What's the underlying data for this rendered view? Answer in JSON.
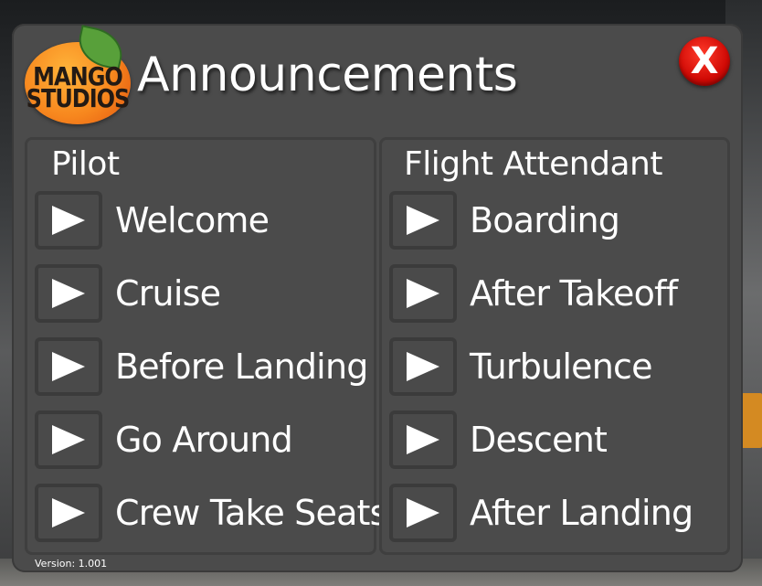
{
  "app": {
    "title": "Announcements",
    "version": "Version: 1.001",
    "close_label": "X"
  },
  "logo": {
    "line1": "MANGO",
    "line2": "STUDIOS"
  },
  "pilot": {
    "heading": "Pilot",
    "items": [
      {
        "label": "Welcome",
        "icon": "play-icon"
      },
      {
        "label": "Cruise",
        "icon": "play-icon"
      },
      {
        "label": "Before Landing",
        "icon": "play-icon"
      },
      {
        "label": "Go Around",
        "icon": "play-icon"
      },
      {
        "label": "Crew Take Seats",
        "icon": "play-icon"
      }
    ]
  },
  "flight_attendant": {
    "heading": "Flight Attendant",
    "items": [
      {
        "label": "Boarding",
        "icon": "play-icon"
      },
      {
        "label": "After Takeoff",
        "icon": "play-icon"
      },
      {
        "label": "Turbulence",
        "icon": "play-icon"
      },
      {
        "label": "Descent",
        "icon": "play-icon"
      },
      {
        "label": "After Landing",
        "icon": "play-icon"
      }
    ]
  },
  "colors": {
    "window_bg": "#4b4b4b",
    "close_red": "#d00a05",
    "logo_orange": "#f7871e",
    "logo_leaf": "#58a03a",
    "text": "#ffffff"
  }
}
